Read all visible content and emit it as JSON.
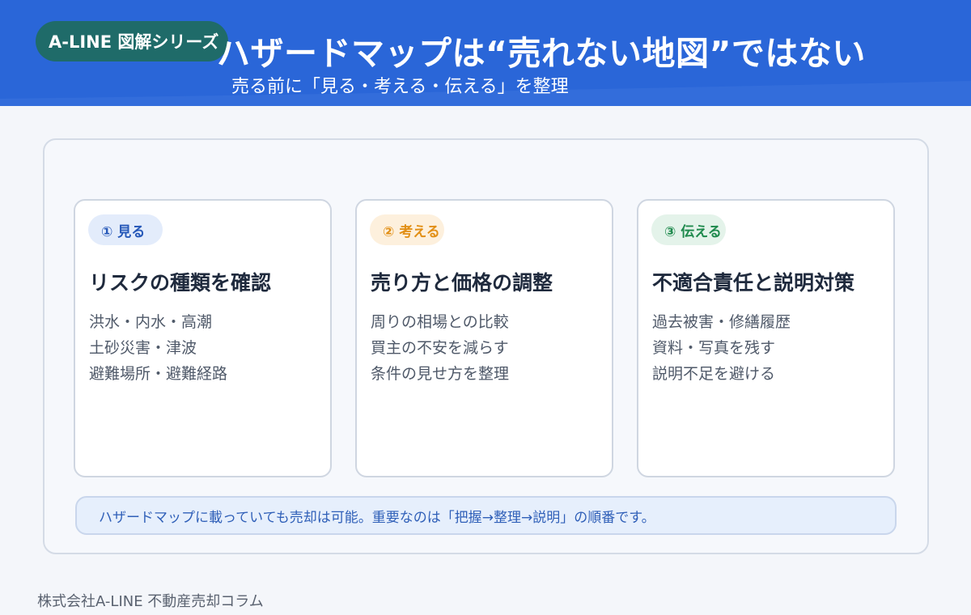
{
  "header": {
    "series_label": "A-LINE 図解シリーズ",
    "title": "ハザードマップは“売れない地図”ではない",
    "subtitle": "売る前に「見る・考える・伝える」を整理"
  },
  "cards": [
    {
      "step": "① 見る",
      "title": "リスクの種類を確認",
      "items": [
        "洪水・内水・高潮",
        "土砂災害・津波",
        "避難場所・避難経路"
      ]
    },
    {
      "step": "② 考える",
      "title": "売り方と価格の調整",
      "items": [
        "周りの相場との比較",
        "買主の不安を減らす",
        "条件の見せ方を整理"
      ]
    },
    {
      "step": "③ 伝える",
      "title": "不適合責任と説明対策",
      "items": [
        "過去被害・修繕履歴",
        "資料・写真を残す",
        "説明不足を避ける"
      ]
    }
  ],
  "note": "ハザードマップに載っていても売却は可能。重要なのは「把握→整理→説明」の順番です。",
  "footer": "株式会社A-LINE 不動産売却コラム",
  "colors": {
    "header_blue": "#2a66d8",
    "series_pill": "#1f6b69",
    "step1": "#2658b8",
    "step2": "#e28f15",
    "step3": "#1f8a4d"
  }
}
